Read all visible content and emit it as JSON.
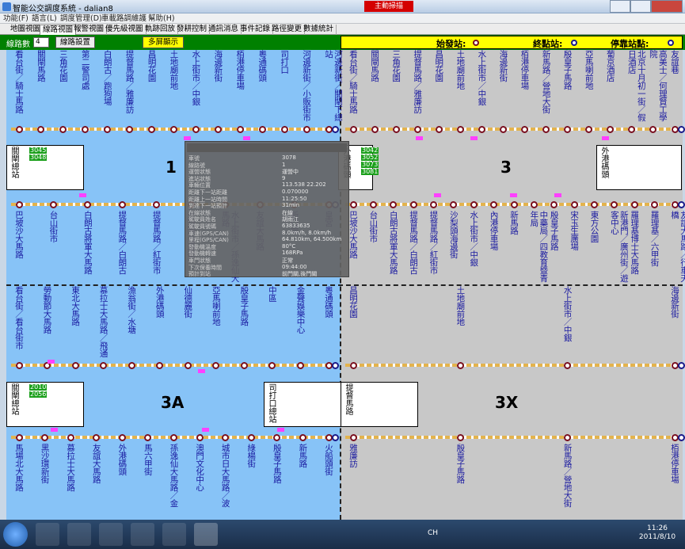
{
  "window": {
    "title": "智能公交調度系統 - dalian8",
    "alert": "主動掃描"
  },
  "menu": [
    "功能(F)",
    "語言(L)",
    "調度管理(D)",
    "車載路調維護",
    "幫助(H)"
  ],
  "tabs": [
    "地圖視圖",
    "線路視圖",
    "報警視圖",
    "優先級視圖",
    "軌跡回放",
    "發耕控制",
    "通訊消息",
    "事件記錄",
    "路徑變更",
    "數據統計"
  ],
  "toolbar": {
    "route_count_label": "線路數",
    "route_count_value": "4",
    "settings_button": "線路設置",
    "multi_screen_button": "多屏顯示"
  },
  "legend": {
    "start": "始發站:",
    "end": "終點站:",
    "stop": "停靠站點:"
  },
  "panels": {
    "p1": {
      "num": "1",
      "depot": "關閘總站",
      "box_ids": [
        "3045",
        "3048"
      ],
      "end_depot": "關閘總站",
      "top": [
        "看台街／騎士馬路",
        "關閘馬路",
        "三角花園",
        "第二警司處",
        "白朗古／跑狗場",
        "提督馬路／雅廉訪",
        "昌明花園",
        "土地廟前地",
        "水上街市／中銀",
        "海邊新街",
        "栢港停車場",
        "粵通碼頭",
        "司打口",
        "河邊新街／小販街市",
        "河邊新街／關閘下總站"
      ],
      "bottom": [
        "巴坡沙大馬路",
        "台山街市",
        "白朗古將軍大馬路",
        "提督馬路／白朗古",
        "提督馬路／紅街市",
        "沙梨頭海邊街",
        "水上街市／孫逸仙大馬路",
        "友誼大馬路",
        "新口岸",
        "皇宮"
      ]
    },
    "p2": {
      "num": "3",
      "box_ids": [
        "3042",
        "3052",
        "3073",
        "3081"
      ],
      "end_depot": "外港碼頭",
      "top": [
        "看台街／騎士馬路",
        "關閘馬路",
        "三角花園",
        "提督馬路／雅廉訪",
        "昌明花園",
        "土地廟前地",
        "水上街市／中銀",
        "海邊新街",
        "栢港停車場",
        "新馬路／營地大街",
        "殷皇子馬路",
        "亞馬喇前地",
        "葡京酒店",
        "北京十月初一街／假日酒店",
        "高美士／何理賢工學院",
        "友誼巷"
      ],
      "bottom": [
        "巴坡沙大馬路",
        "台山街市",
        "白朗古將軍大馬路",
        "提督馬路／白朗古",
        "提督馬路／紅街市",
        "沙梨頭海邊街",
        "水上街市／中銀",
        "內港停車場",
        "新馬路",
        "中藥局／四教育暨青年局",
        "殷皇子馬路",
        "宋玉生廣場",
        "東方公園",
        "新港門／廣州街／遊客中心",
        "羅理基博士大馬路",
        "羅理基／六甲街",
        "友誼大馬路／行車天橋"
      ]
    },
    "p3": {
      "num": "3A",
      "depot": "關閘總站",
      "box_ids": [
        "2010",
        "2056"
      ],
      "mid_depot": "司打口總站",
      "top": [
        "看台街／看台街市",
        "勞動節大馬路",
        "東北大馬路",
        "慕拉士大馬路／飛通",
        "漁翁街／水塘",
        "外港碼頭",
        "仙德麗街",
        "亞馬喇前地",
        "殷皇子馬路",
        "中區",
        "金聲娛樂中心",
        "粵通碼頭"
      ],
      "bottom": [
        "馬場北大馬路",
        "黑沙環新街",
        "慕拉士大馬路",
        "友誼大馬路",
        "外港碼頭",
        "馬六甲街",
        "孫逸仙大馬路／金",
        "澳門文化中心",
        "城市日大馬路／波",
        "綠楊街",
        "殷皇子馬路",
        "新馬路",
        "火船頭街"
      ]
    },
    "p4": {
      "num": "3X",
      "depot": "提督馬路",
      "box_ids": [],
      "top": [
        "昌明花園",
        "土地廟前地",
        "水上街市／中銀",
        "海邊新街"
      ],
      "bottom": [
        "雅廉訪",
        "殷皇子馬路",
        "新馬路／營地大街",
        "栢港停車場"
      ]
    }
  },
  "popup": {
    "rows": [
      [
        "車號",
        "3078"
      ],
      [
        "線路號",
        "1"
      ],
      [
        "運營狀態",
        "運營中"
      ],
      [
        "進站狀態",
        "9"
      ],
      [
        "車輛位置",
        "113.538 22.202"
      ],
      [
        "距離下一站距離",
        "0.070000"
      ],
      [
        "距離上一站時間",
        "11:25:50"
      ],
      [
        "到達下一站預計",
        "31min"
      ],
      [
        "在線狀態",
        "在線"
      ],
      [
        "駕駛員姓名",
        "胡雨江"
      ],
      [
        "駕駛員號碼",
        "63833635"
      ],
      [
        "車速(GPS/CAN)",
        "8.0km/h, 8.0km/h"
      ],
      [
        "里程(GPS/CAN)",
        "64.810km, 64.500km"
      ],
      [
        "發動機溫度",
        "80°C"
      ],
      [
        "發動機轉速",
        "168RPa"
      ],
      [
        "車門狀態",
        "正常"
      ],
      [
        "下次保養時間",
        "09:44:00"
      ],
      [
        "預計到站",
        "前門關,後門關"
      ]
    ]
  },
  "taskbar": {
    "time": "11:26",
    "date": "2011/8/10",
    "lang": "CH"
  }
}
